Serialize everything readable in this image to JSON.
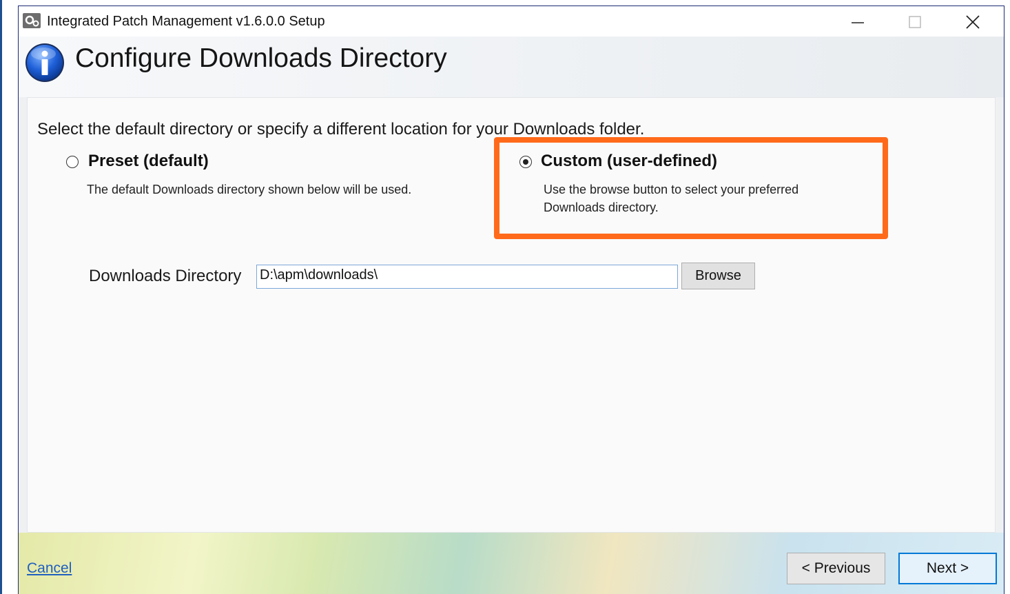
{
  "window": {
    "title": "Integrated Patch Management v1.6.0.0 Setup",
    "icons": [
      "app-icon",
      "minimize-icon",
      "maximize-icon",
      "close-icon"
    ]
  },
  "header": {
    "title": "Configure Downloads Directory",
    "icon": "info-icon"
  },
  "content": {
    "instruction": "Select the default directory or specify a different location for your Downloads folder.",
    "options": [
      {
        "label": "Preset (default)",
        "description": "The default Downloads directory shown below will be used.",
        "selected": false
      },
      {
        "label": "Custom (user-defined)",
        "description_line1": "Use the browse button to select your preferred",
        "description_line2": "Downloads directory.",
        "selected": true
      }
    ],
    "directory": {
      "label": "Downloads Directory",
      "value": "D:\\apm\\downloads\\",
      "browse_label": "Browse"
    }
  },
  "footer": {
    "cancel_label": "Cancel",
    "previous_label": "< Previous",
    "next_label": "Next >"
  },
  "colors": {
    "highlight": "#ff6a1a",
    "link": "#1f5fbf",
    "accent": "#0078d7"
  }
}
